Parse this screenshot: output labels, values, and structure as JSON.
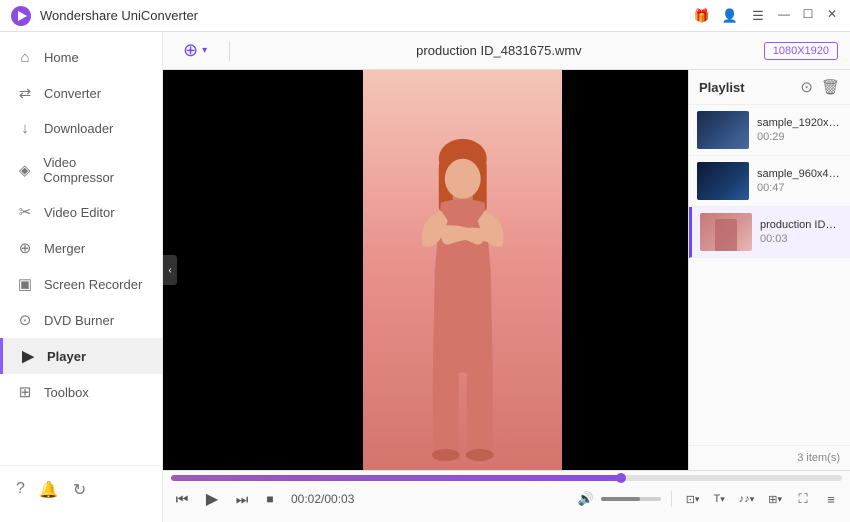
{
  "app": {
    "title": "Wondershare UniConverter",
    "logo_color": "#8b4de0"
  },
  "titlebar": {
    "minimize": "—",
    "maximize": "☐",
    "close": "✕",
    "icons": [
      "🎁",
      "👤",
      "☰"
    ]
  },
  "sidebar": {
    "items": [
      {
        "id": "home",
        "label": "Home",
        "icon": "⌂"
      },
      {
        "id": "converter",
        "label": "Converter",
        "icon": "↔"
      },
      {
        "id": "downloader",
        "label": "Downloader",
        "icon": "↓"
      },
      {
        "id": "video-compressor",
        "label": "Video Compressor",
        "icon": "◈"
      },
      {
        "id": "video-editor",
        "label": "Video Editor",
        "icon": "✂"
      },
      {
        "id": "merger",
        "label": "Merger",
        "icon": "⊕"
      },
      {
        "id": "screen-recorder",
        "label": "Screen Recorder",
        "icon": "▣"
      },
      {
        "id": "dvd-burner",
        "label": "DVD Burner",
        "icon": "⊙"
      },
      {
        "id": "player",
        "label": "Player",
        "icon": "▶",
        "active": true
      },
      {
        "id": "toolbox",
        "label": "Toolbox",
        "icon": "⚙"
      }
    ],
    "bottom_icons": [
      "?",
      "🔔",
      "↻"
    ]
  },
  "player": {
    "add_label": "+ ▾",
    "filename": "production ID_4831675.wmv",
    "resolution": "1080X1920",
    "current_time": "00:02",
    "total_time": "00:03",
    "progress_percent": 67
  },
  "playlist": {
    "title": "Playlist",
    "items_count": "3 item(s)",
    "items": [
      {
        "id": 1,
        "name": "sample_1920x10...",
        "duration": "00:29",
        "thumb_type": "landscape",
        "active": false
      },
      {
        "id": 2,
        "name": "sample_960x400...",
        "duration": "00:47",
        "thumb_type": "ocean",
        "active": false
      },
      {
        "id": 3,
        "name": "production ID_4...",
        "duration": "00:03",
        "thumb_type": "pink",
        "active": true
      }
    ]
  },
  "controls": {
    "prev": "⏮",
    "play": "▶",
    "next": "⏭",
    "stop": "■",
    "volume_icon": "🔊",
    "subtitle_icon": "CC",
    "text_icon": "T",
    "audio_icon": "♪",
    "video_icon": "🎬",
    "fullscreen_icon": "⛶",
    "more_icon": "≡"
  }
}
